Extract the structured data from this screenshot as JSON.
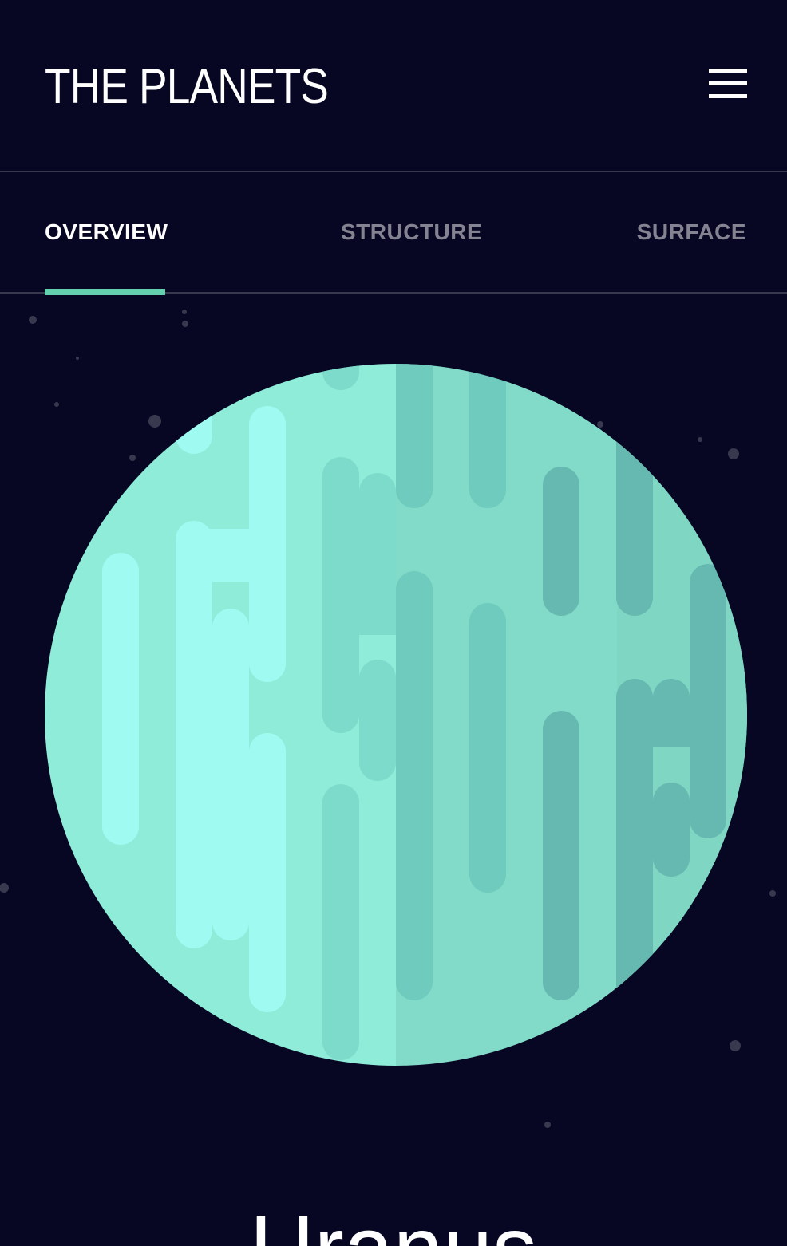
{
  "header": {
    "logo": "THE PLANETS",
    "menu_icon": "hamburger-menu-icon"
  },
  "tabs": [
    {
      "label": "OVERVIEW",
      "active": true
    },
    {
      "label": "STRUCTURE",
      "active": false
    },
    {
      "label": "SURFACE",
      "active": false
    }
  ],
  "planet": {
    "name": "Uranus",
    "image": "uranus-planet-illustration"
  },
  "colors": {
    "background": "#070724",
    "accent": "#65D0AE",
    "divider": "#38384F",
    "text": "#FFFFFF"
  }
}
